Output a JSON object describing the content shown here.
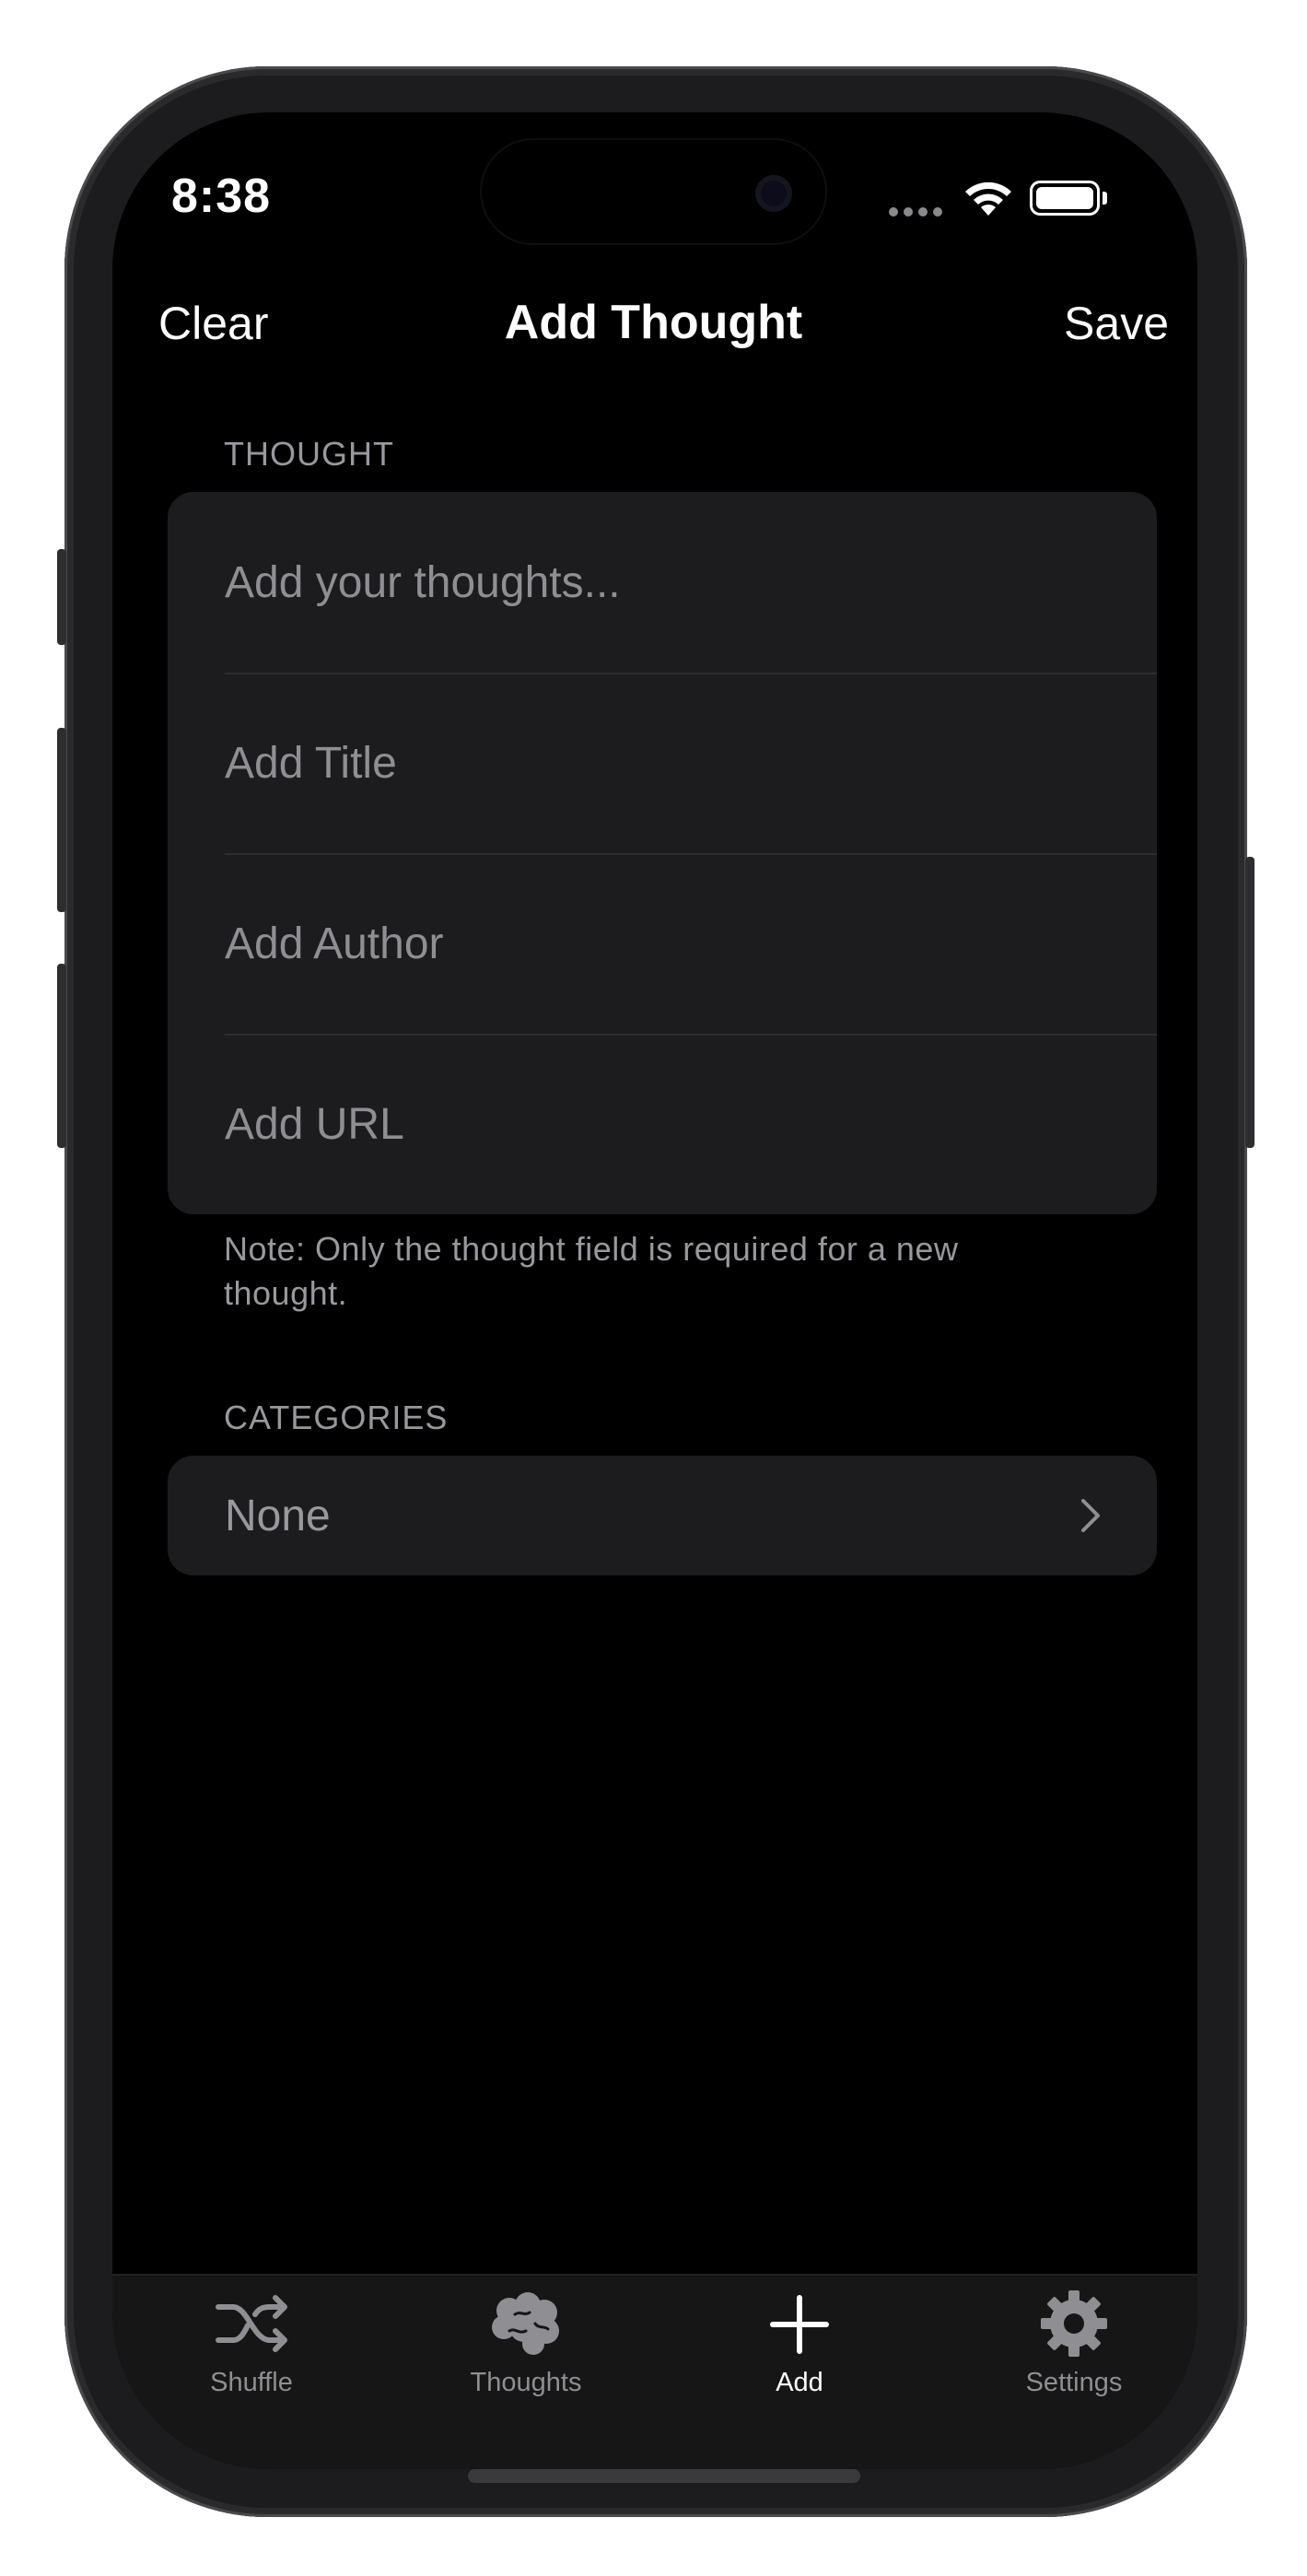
{
  "status_bar": {
    "time": "8:38",
    "icons": [
      "signal-dots-icon",
      "wifi-icon",
      "battery-icon"
    ]
  },
  "nav": {
    "left_label": "Clear",
    "title": "Add Thought",
    "right_label": "Save"
  },
  "thought_section": {
    "header": "THOUGHT",
    "fields": [
      {
        "placeholder": "Add your thoughts...",
        "value": ""
      },
      {
        "placeholder": "Add Title",
        "value": ""
      },
      {
        "placeholder": "Add Author",
        "value": ""
      },
      {
        "placeholder": "Add URL",
        "value": ""
      }
    ],
    "note": "Note: Only the thought field is required for a new thought."
  },
  "categories_section": {
    "header": "CATEGORIES",
    "selected": "None",
    "icon": "chevron-right-icon"
  },
  "tabs": [
    {
      "label": "Shuffle",
      "icon": "shuffle-icon",
      "active": false
    },
    {
      "label": "Thoughts",
      "icon": "brain-icon",
      "active": false
    },
    {
      "label": "Add",
      "icon": "plus-icon",
      "active": true
    },
    {
      "label": "Settings",
      "icon": "gear-icon",
      "active": false
    }
  ],
  "colors": {
    "background": "#000000",
    "card": "#1c1c1e",
    "secondary_text": "#98989d",
    "active_tab": "#ffffff",
    "inactive_tab": "#8e8e93"
  }
}
